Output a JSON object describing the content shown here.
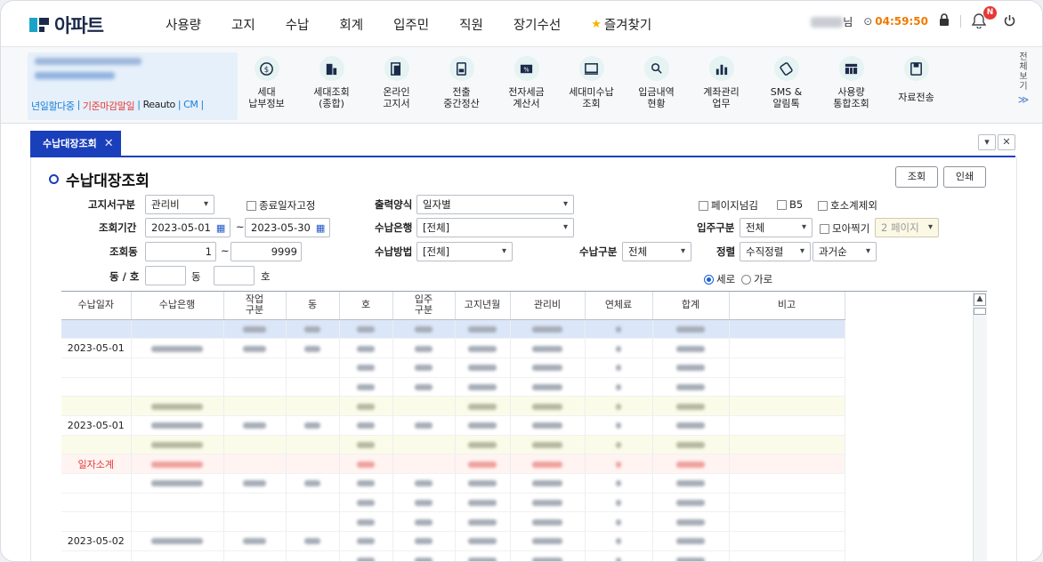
{
  "app": {
    "logo_text": "아파트"
  },
  "nav": {
    "items": [
      "사용량",
      "고지",
      "수납",
      "회계",
      "입주민",
      "직원",
      "장기수선"
    ],
    "favorites": "즐겨찾기"
  },
  "user": {
    "suffix": "님",
    "timer": "04:59:50",
    "notifications_badge": "N"
  },
  "site": {
    "links": [
      "년일할다중",
      "기준마감말일",
      "Reauto",
      "CM"
    ],
    "link_colors": [
      "#1a7fd0",
      "#e53935",
      "#222222",
      "#1a7fd0"
    ]
  },
  "quick_menu": [
    {
      "icon": "coin-icon",
      "line1": "세대",
      "line2": "납부정보"
    },
    {
      "icon": "building-icon",
      "line1": "세대조회",
      "line2": "(종합)"
    },
    {
      "icon": "doc-icon",
      "line1": "온라인",
      "line2": "고지서"
    },
    {
      "icon": "calc-doc-icon",
      "line1": "전출",
      "line2": "중간정산"
    },
    {
      "icon": "tax-invoice-icon",
      "line1": "전자세금",
      "line2": "계산서"
    },
    {
      "icon": "unpaid-icon",
      "line1": "세대미수납",
      "line2": "조회"
    },
    {
      "icon": "deposit-icon",
      "line1": "입금내역",
      "line2": "현황"
    },
    {
      "icon": "account-icon",
      "line1": "계좌관리",
      "line2": "업무"
    },
    {
      "icon": "sms-icon",
      "line1": "SMS &",
      "line2": "알림톡"
    },
    {
      "icon": "usage-table-icon",
      "line1": "사용량",
      "line2": "통합조회"
    },
    {
      "icon": "save-icon",
      "line1": "자료전송",
      "line2": ""
    }
  ],
  "all_view_label": [
    "전",
    "체",
    "보",
    "기"
  ],
  "tab": {
    "label": "수납대장조회"
  },
  "page": {
    "title": "수납대장조회",
    "buttons": {
      "search": "조회",
      "print": "인쇄"
    }
  },
  "form": {
    "notice_type_label": "고지서구분",
    "notice_type_value": "관리비",
    "fix_end_date_label": "종료일자고정",
    "output_format_label": "출력양식",
    "output_format_value": "일자별",
    "page_break_label": "페이지넘김",
    "b5_label": "B5",
    "exclude_unit_total_label": "호소계제외",
    "period_label": "조회기간",
    "period_from": "2023-05-01",
    "period_tilde": "~",
    "period_to": "2023-05-30",
    "bank_label": "수납은행",
    "bank_value": "[전체]",
    "resident_type_label": "입주구분",
    "resident_type_value": "전체",
    "collect_label": "모아찍기",
    "collect_value": "2 페이지",
    "dong_label": "조회동",
    "dong_from": "1",
    "dong_tilde": "~",
    "dong_to": "9999",
    "method_label": "수납방법",
    "method_value": "[전체]",
    "payment_type_label": "수납구분",
    "payment_type_value": "전체",
    "sort_label": "정렬",
    "sort_value": "수직정렬",
    "sort_order_value": "과거순",
    "dongho_label": "동 / 호",
    "dong_suffix": "동",
    "ho_suffix": "호",
    "vertical_label": "세로",
    "horizontal_label": "가로"
  },
  "grid": {
    "columns": [
      "수납일자",
      "수납은행",
      "작업\n구분",
      "동",
      "호",
      "입주\n구분",
      "고지년월",
      "관리비",
      "연체료",
      "합계",
      "비고"
    ],
    "rows": [
      {
        "type": "sel",
        "date": ""
      },
      {
        "type": "normal",
        "date": "2023-05-01"
      },
      {
        "type": "normal",
        "date": ""
      },
      {
        "type": "normal",
        "date": ""
      },
      {
        "type": "sub",
        "date": ""
      },
      {
        "type": "normal",
        "date": "2023-05-01"
      },
      {
        "type": "sub",
        "date": ""
      },
      {
        "type": "tot",
        "date": "일자소계"
      },
      {
        "type": "normal",
        "date": ""
      },
      {
        "type": "normal",
        "date": ""
      },
      {
        "type": "normal",
        "date": ""
      },
      {
        "type": "normal",
        "date": "2023-05-02"
      },
      {
        "type": "normal",
        "date": ""
      },
      {
        "type": "normal",
        "date": ""
      }
    ]
  }
}
